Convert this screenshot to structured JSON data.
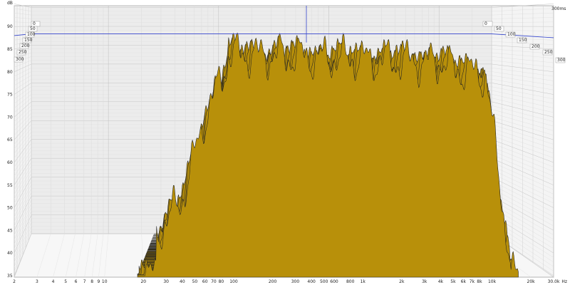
{
  "chart_data": {
    "type": "area",
    "subtype": "waterfall",
    "y_unit": "dB",
    "x_unit": "Hz",
    "ylim": [
      35,
      95
    ],
    "y_ticks": [
      "90",
      "85",
      "80",
      "75",
      "70",
      "65",
      "60",
      "55",
      "50",
      "45",
      "40",
      "35"
    ],
    "x_ticks": [
      "2",
      "3",
      "4",
      "5",
      "6",
      "7",
      "8",
      "9",
      "10",
      "20",
      "30",
      "40",
      "50",
      "60",
      "70",
      "80",
      "100",
      "200",
      "300",
      "400",
      "500",
      "600",
      "800",
      "1k",
      "2k",
      "3k",
      "4k",
      "5k",
      "6k",
      "7k",
      "8k",
      "10k",
      "20k",
      "30.0k"
    ],
    "x_unit_label": "Hz",
    "time_slices_left": [
      "0",
      "50",
      "100",
      "150",
      "200",
      "250",
      "300"
    ],
    "time_slices_right": [
      "0",
      "50",
      "100",
      "150",
      "200",
      "250",
      "300"
    ],
    "time_max_label": "300ms",
    "cursor_y_level": 88,
    "grid": true,
    "fill_color": "#b8900a",
    "edge_color": "#222222",
    "cursor_color": "#3344cc",
    "n_slices": 46
  }
}
